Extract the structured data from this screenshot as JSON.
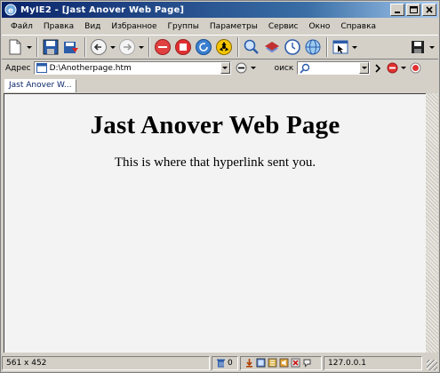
{
  "window": {
    "title": "MyIE2 - [Jast Anover Web Page]"
  },
  "menu": {
    "items": [
      "Файл",
      "Правка",
      "Вид",
      "Избранное",
      "Группы",
      "Параметры",
      "Сервис",
      "Окно",
      "Справка"
    ]
  },
  "address": {
    "label": "Адрес",
    "value": "D:\\Anotherpage.htm",
    "search_label": "оиск"
  },
  "tabs": [
    {
      "label": "Jast Anover W..."
    }
  ],
  "page": {
    "heading": "Jast Anover Web Page",
    "body": "This is where that hyperlink sent you."
  },
  "status": {
    "size": "561 x 452",
    "trash_count": "0",
    "ip": "127.0.0.1"
  },
  "colors": {
    "title_bar": "#0a246a",
    "window_face": "#d4d0c8",
    "content_bg": "#f3f3f3"
  }
}
